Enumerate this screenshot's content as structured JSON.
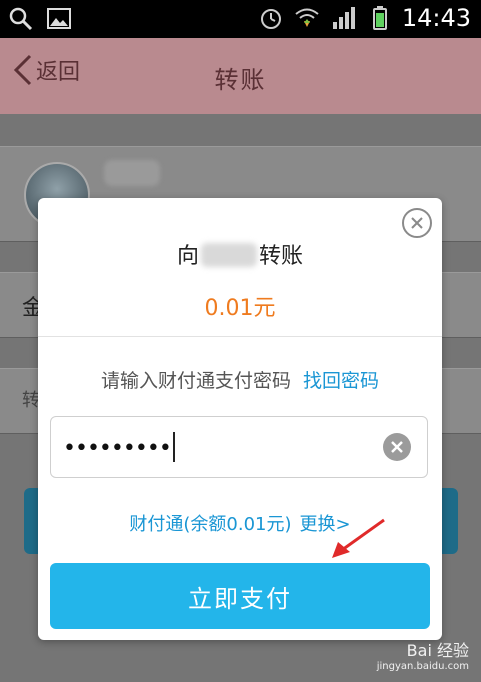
{
  "status_bar": {
    "time": "14:43"
  },
  "header": {
    "back_label": "返回",
    "title": "转账"
  },
  "underlying": {
    "amount_label": "金",
    "note_label": "转"
  },
  "dialog": {
    "recipient_prefix": "向",
    "recipient_suffix": "转账",
    "amount": "0.01元",
    "prompt": "请输入财付通支付密码",
    "forgot_link": "找回密码",
    "password_mask": "•••••••••",
    "payment_method": "财付通(余额0.01元)",
    "change_link": "更换>",
    "pay_button": "立即支付"
  },
  "watermark": {
    "logo": "Bai 经验",
    "url": "jingyan.baidu.com"
  },
  "colors": {
    "accent": "#23b5ea",
    "link": "#1a96d4",
    "amount": "#ef7b1f",
    "annotation_arrow": "#e02a2a"
  }
}
